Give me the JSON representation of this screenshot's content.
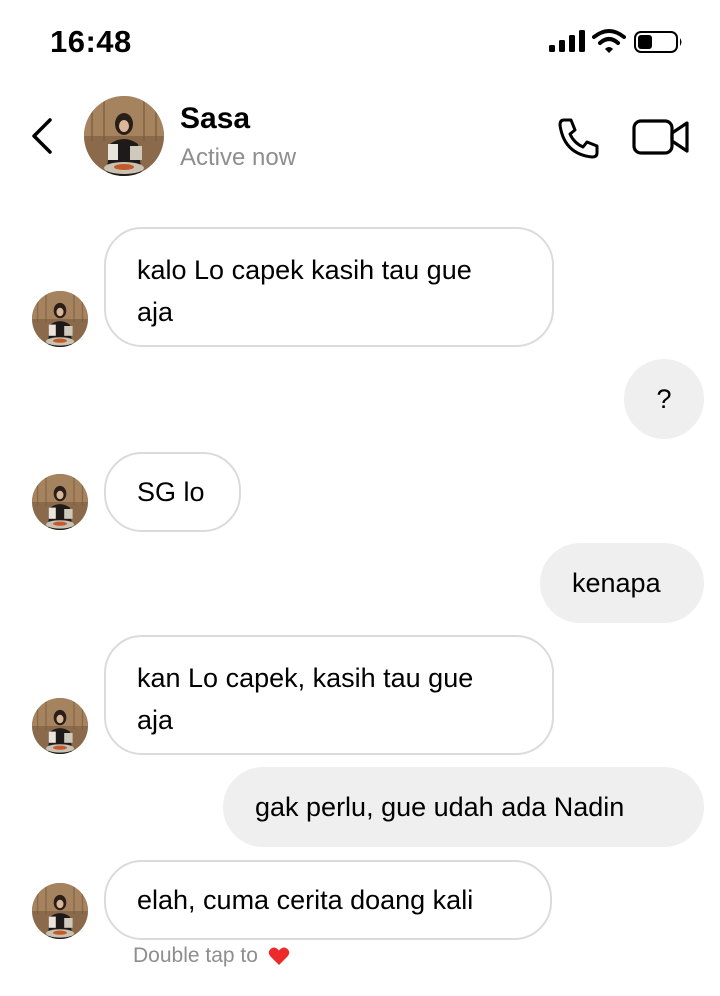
{
  "status_bar": {
    "time": "16:48"
  },
  "header": {
    "name": "Sasa",
    "status": "Active now"
  },
  "messages": [
    {
      "from": "them",
      "line1": "kalo Lo capek kasih tau gue",
      "line2": "aja"
    },
    {
      "from": "me",
      "text": "?"
    },
    {
      "from": "them",
      "text": "SG lo"
    },
    {
      "from": "me",
      "text": "kenapa"
    },
    {
      "from": "them",
      "line1": "kan Lo capek, kasih tau gue",
      "line2": "aja"
    },
    {
      "from": "me",
      "text": "gak perlu, gue udah ada Nadin"
    },
    {
      "from": "them",
      "text": "elah, cuma cerita doang kali"
    }
  ],
  "hint": {
    "text": "Double tap to"
  },
  "icons": {
    "back": "chevron-left-icon",
    "call": "phone-icon",
    "video": "video-camera-icon",
    "heart": "heart-icon"
  },
  "colors": {
    "incoming_border": "#dbdbdb",
    "outgoing_bg": "#efefef",
    "muted_text": "#8e8e8e",
    "heart": "#ed2a2a"
  }
}
